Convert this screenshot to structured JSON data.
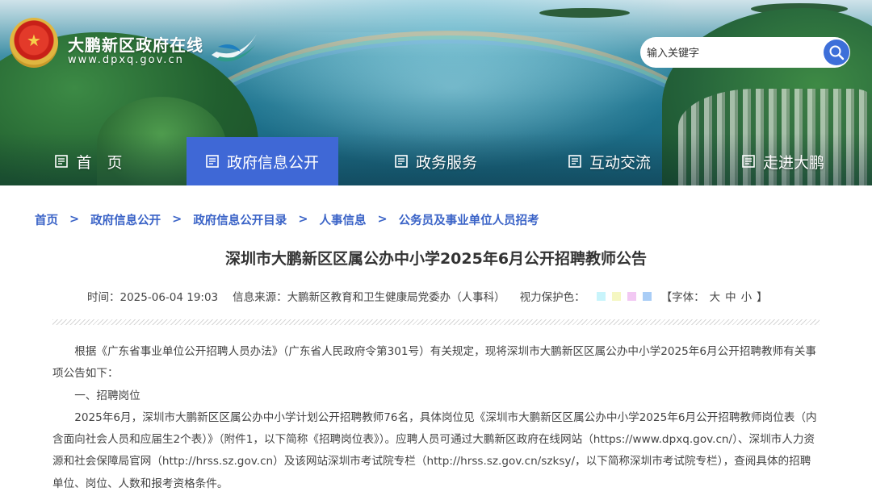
{
  "header": {
    "site_title": "大鹏新区政府在线",
    "site_url": "www.dpxq.gov.cn",
    "search_placeholder": "输入关键字"
  },
  "nav": {
    "items": [
      {
        "label": "首　页",
        "icon": "page-icon",
        "active": false
      },
      {
        "label": "政府信息公开",
        "icon": "page-icon",
        "active": true
      },
      {
        "label": "政务服务",
        "icon": "page-icon",
        "active": false
      },
      {
        "label": "互动交流",
        "icon": "page-icon",
        "active": false
      },
      {
        "label": "走进大鹏",
        "icon": "page-icon",
        "active": false
      }
    ]
  },
  "breadcrumb": {
    "separator": ">",
    "items": [
      "首页",
      "政府信息公开",
      "政府信息公开目录",
      "人事信息",
      "公务员及事业单位人员招考"
    ]
  },
  "article": {
    "title": "深圳市大鹏新区区属公办中小学2025年6月公开招聘教师公告",
    "meta": {
      "time": "时间：2025-06-04 19:03",
      "source": "信息来源：大鹏新区教育和卫生健康局党委办（人事科）",
      "eye_protect_label": "视力保护色：",
      "swatch_colors": [
        "#c8f4fb",
        "#f5f7c2",
        "#f2c8f3",
        "#a9cdf6"
      ],
      "font_open": "【字体：",
      "font_large": "大",
      "font_medium": "中",
      "font_small": "小",
      "font_close": "】"
    },
    "paragraphs": [
      "根据《广东省事业单位公开招聘人员办法》（广东省人民政府令第301号）有关规定，现将深圳市大鹏新区区属公办中小学2025年6月公开招聘教师有关事项公告如下：",
      "一、招聘岗位",
      "2025年6月，深圳市大鹏新区区属公办中小学计划公开招聘教师76名，具体岗位见《深圳市大鹏新区区属公办中小学2025年6月公开招聘教师岗位表（内含面向社会人员和应届生2个表）》（附件1，以下简称《招聘岗位表》）。应聘人员可通过大鹏新区政府在线网站（https://www.dpxq.gov.cn/）、深圳市人力资源和社会保障局官网（http://hrss.sz.gov.cn）及该网站深圳市考试院专栏（http://hrss.sz.gov.cn/szksy/，以下简称深圳市考试院专栏），查阅具体的招聘单位、岗位、人数和报考资格条件。"
    ]
  },
  "colors": {
    "accent": "#3f68d6",
    "breadcrumb": "#3a63c7",
    "search_button": "#3d6fd9"
  }
}
